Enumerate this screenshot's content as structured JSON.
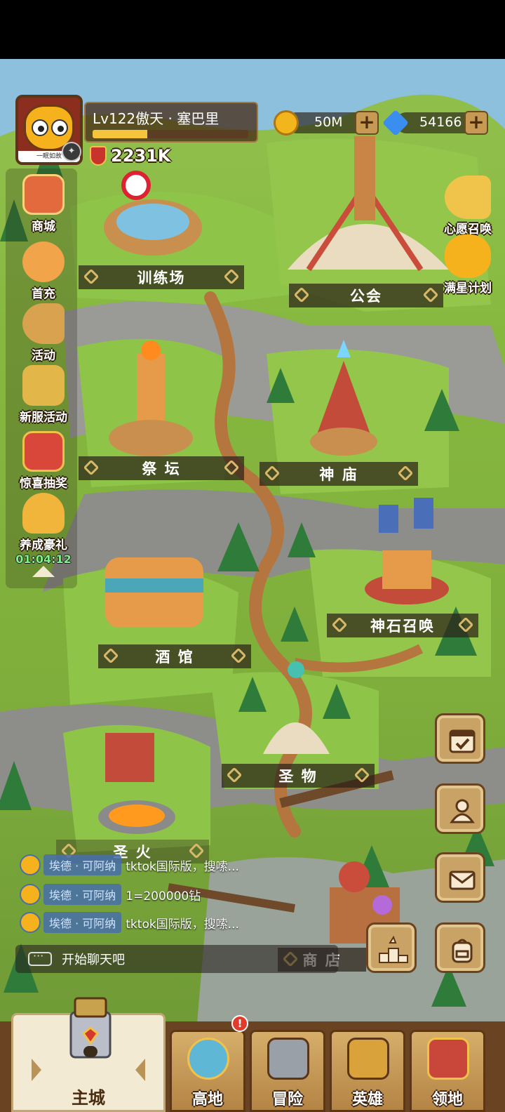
{
  "player": {
    "level_name": "Lv122傲天 · 塞巴里",
    "avatar_caption": "一眠如故",
    "power": "2231K",
    "xp_fraction": 0.35
  },
  "currencies": {
    "gold": "50M",
    "diamonds": "54166",
    "plus_symbol": "+"
  },
  "side_menu": {
    "items": [
      {
        "label": "商城",
        "icon": "shop-icon"
      },
      {
        "label": "首充",
        "icon": "girl-portrait-icon"
      },
      {
        "label": "活动",
        "icon": "horn-icon"
      },
      {
        "label": "新服活动",
        "icon": "gift-burst-icon"
      },
      {
        "label": "惊喜抽奖",
        "icon": "slot-machine-icon"
      },
      {
        "label": "养成豪礼",
        "icon": "treasure-bag-icon"
      }
    ],
    "timer": "01:04:12"
  },
  "right_features": {
    "wish_summon": "心愿召唤",
    "full_star_plan": "满星计划"
  },
  "buildings": {
    "training": "训练场",
    "guild": "公会",
    "altar": "祭 坛",
    "temple": "神 庙",
    "tavern": "酒 馆",
    "summon": "神石召唤",
    "relic": "圣 物",
    "holy_fire": "圣 火",
    "shop": "商 店"
  },
  "chat": {
    "messages": [
      {
        "name": "埃德 · 可阿纳",
        "text": "tktok国际版，搜嗦..."
      },
      {
        "name": "埃德 · 可阿纳",
        "text": "1=200000钻"
      },
      {
        "name": "埃德 · 可阿纳",
        "text": "tktok国际版，搜嗦..."
      }
    ],
    "placeholder": "开始聊天吧"
  },
  "bottom_nav": {
    "main": "主城",
    "tabs": [
      "高地",
      "冒险",
      "英雄",
      "领地"
    ],
    "alert": "!"
  },
  "colors": {
    "gold_coin": "#f2b51b",
    "diamond": "#3a8ef0",
    "timer_green": "#7ff08a",
    "alert_red": "#e13b2b"
  }
}
